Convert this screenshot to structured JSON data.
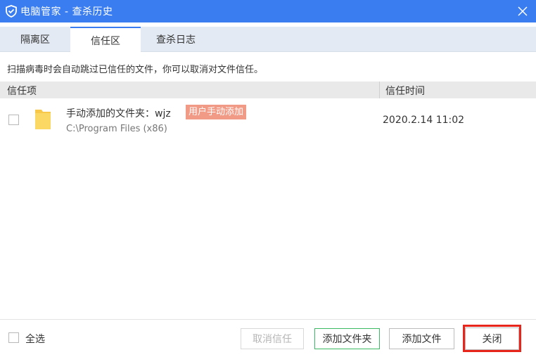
{
  "window": {
    "title": "电脑管家 - 查杀历史",
    "brand_color": "#3a7df0"
  },
  "tabs": [
    {
      "label": "隔离区",
      "active": false
    },
    {
      "label": "信任区",
      "active": true
    },
    {
      "label": "查杀日志",
      "active": false
    }
  ],
  "notice": "扫描病毒时会自动跳过已信任的文件，你可以取消对文件信任。",
  "table": {
    "headers": [
      "信任项",
      "信任时间"
    ],
    "rows": [
      {
        "checked": false,
        "icon": "folder-icon",
        "name": "手动添加的文件夹：wjz",
        "badge": "用户手动添加",
        "path": "C:\\Program Files (x86)",
        "time": "2020.2.14 11:02"
      }
    ]
  },
  "footer": {
    "select_all": "全选",
    "buttons": {
      "cancel_trust": "取消信任",
      "add_folder": "添加文件夹",
      "add_file": "添加文件",
      "close": "关闭"
    }
  },
  "colors": {
    "badge": "#f19a86",
    "add_folder_border": "#3cba62",
    "close_highlight": "#e8251b",
    "folder": "#f7c84a"
  }
}
